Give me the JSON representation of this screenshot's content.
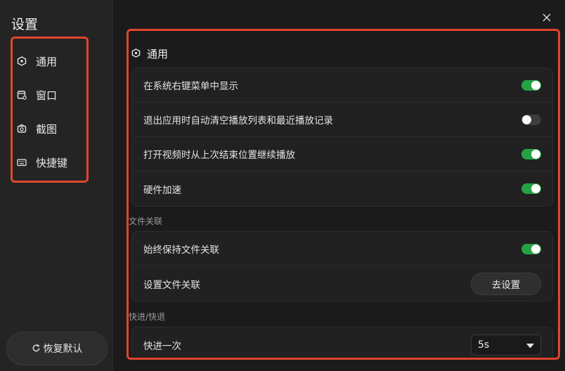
{
  "dialog": {
    "title": "设置",
    "close_icon": "close-icon"
  },
  "sidebar": {
    "items": [
      {
        "label": "通用",
        "icon": "hexagon-icon",
        "active": true
      },
      {
        "label": "窗口",
        "icon": "window-icon",
        "active": false
      },
      {
        "label": "截图",
        "icon": "camera-icon",
        "active": false
      },
      {
        "label": "快捷键",
        "icon": "keyboard-icon",
        "active": false
      }
    ],
    "reset_label": "恢复默认",
    "reset_icon": "refresh-icon"
  },
  "general": {
    "title": "通用",
    "rows": [
      {
        "label": "在系统右键菜单中显示",
        "on": true
      },
      {
        "label": "退出应用时自动清空播放列表和最近播放记录",
        "on": false
      },
      {
        "label": "打开视频时从上次结束位置继续播放",
        "on": true
      },
      {
        "label": "硬件加速",
        "on": true
      }
    ]
  },
  "file_assoc": {
    "title": "文件关联",
    "always_keep_label": "始终保持文件关联",
    "always_keep_on": true,
    "set_label": "设置文件关联",
    "set_button": "去设置"
  },
  "seek": {
    "title": "快进/快退",
    "forward_label": "快进一次",
    "forward_value": "5s"
  },
  "colors": {
    "accent_toggle": "#25a244",
    "highlight_border": "#e0452f",
    "background": "#1b1b1b"
  }
}
